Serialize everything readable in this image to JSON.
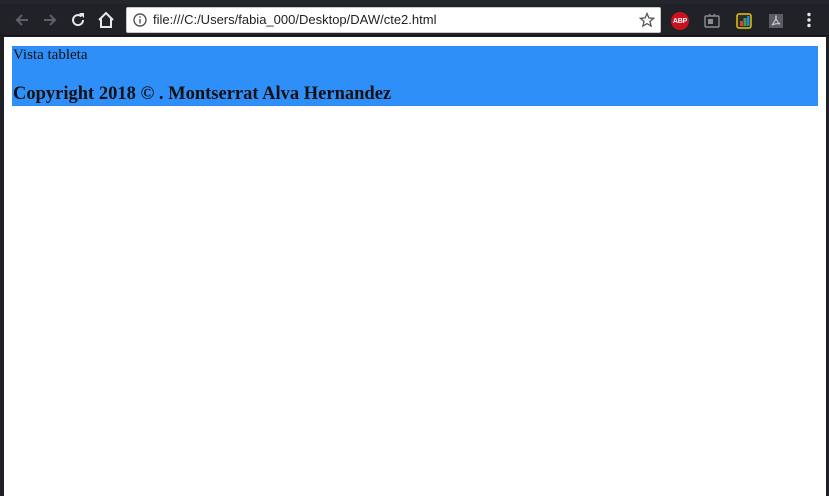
{
  "browser": {
    "url": "file:///C:/Users/fabia_000/Desktop/DAW/cte2.html",
    "icons": {
      "back": "arrow-left-icon",
      "forward": "arrow-right-icon",
      "reload": "reload-icon",
      "home": "home-icon",
      "site_info": "info-icon",
      "bookmark": "star-icon",
      "menu": "kebab-menu-icon"
    },
    "extensions": [
      {
        "name": "abp-extension-icon",
        "label": "ABP"
      },
      {
        "name": "cast-extension-icon"
      },
      {
        "name": "color-picker-extension-icon"
      },
      {
        "name": "pdf-extension-icon"
      }
    ],
    "colors": {
      "toolbar_bg": "#202227",
      "omnibox_bg": "#ffffff"
    }
  },
  "page": {
    "view_label": "Vista tableta",
    "copyright": "Copyright 2018 © . Montserrat Alva Hernandez",
    "colors": {
      "footer_bg": "#2f8ff9",
      "page_bg": "#ffffff"
    }
  }
}
